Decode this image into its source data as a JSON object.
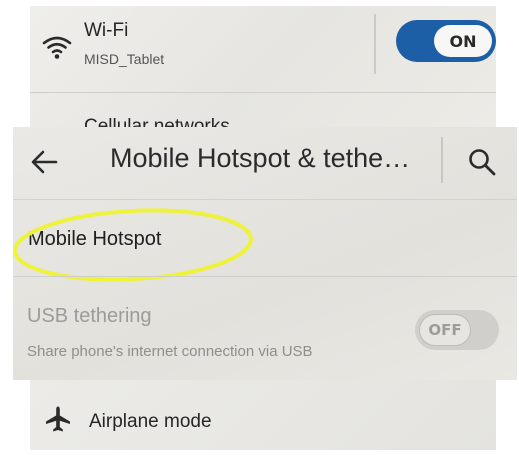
{
  "wifi": {
    "title": "Wi-Fi",
    "network": "MISD_Tablet",
    "toggle_label": "ON",
    "icon": "wifi-icon"
  },
  "cellular": {
    "label": "Cellular networks"
  },
  "header": {
    "title": "Mobile Hotspot & tethe…",
    "back_icon": "back-arrow-icon",
    "search_icon": "search-icon"
  },
  "hotspot": {
    "label": "Mobile Hotspot",
    "highlight_color": "#eef23a"
  },
  "usb_tethering": {
    "title": "USB tethering",
    "subtitle": "Share phone's internet connection via USB",
    "toggle_label": "OFF"
  },
  "airplane": {
    "label": "Airplane mode",
    "icon": "airplane-icon"
  },
  "colors": {
    "toggle_on": "#1d5fa6",
    "toggle_off": "#d0cfcb",
    "text_primary": "#262626",
    "text_disabled": "#9b9b99"
  }
}
